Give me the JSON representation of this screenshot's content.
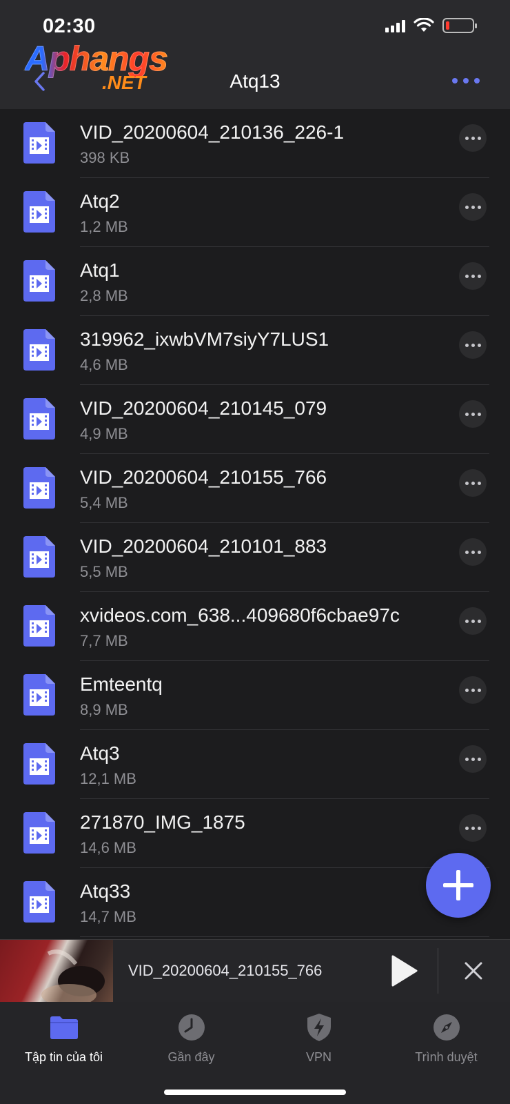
{
  "status_bar": {
    "time": "02:30"
  },
  "watermark": {
    "main": "Aphangs",
    "sub": ".NET"
  },
  "nav": {
    "title": "Atq13"
  },
  "files": [
    {
      "name": "VID_20200604_210136_226-1",
      "size": "398 KB"
    },
    {
      "name": "Atq2",
      "size": "1,2 MB"
    },
    {
      "name": "Atq1",
      "size": "2,8 MB"
    },
    {
      "name": "319962_ixwbVM7siyY7LUS1",
      "size": "4,6 MB"
    },
    {
      "name": "VID_20200604_210145_079",
      "size": "4,9 MB"
    },
    {
      "name": "VID_20200604_210155_766",
      "size": "5,4 MB"
    },
    {
      "name": "VID_20200604_210101_883",
      "size": "5,5 MB"
    },
    {
      "name": "xvideos.com_638...409680f6cbae97c",
      "size": "7,7 MB"
    },
    {
      "name": "Emteentq",
      "size": "8,9 MB"
    },
    {
      "name": "Atq3",
      "size": "12,1 MB"
    },
    {
      "name": "271870_IMG_1875",
      "size": "14,6 MB"
    },
    {
      "name": "Atq33",
      "size": "14,7 MB"
    }
  ],
  "player": {
    "title": "VID_20200604_210155_766"
  },
  "tabs": [
    {
      "label": "Tập tin của tôi",
      "icon": "folder-icon"
    },
    {
      "label": "Gần đây",
      "icon": "clock-icon"
    },
    {
      "label": "VPN",
      "icon": "vpn-shield-icon"
    },
    {
      "label": "Trình duyệt",
      "icon": "compass-icon"
    }
  ],
  "colors": {
    "accent": "#5d6af0",
    "background": "#1c1c1e",
    "header": "#2a2a2d",
    "battery_low": "#ff3b30"
  }
}
